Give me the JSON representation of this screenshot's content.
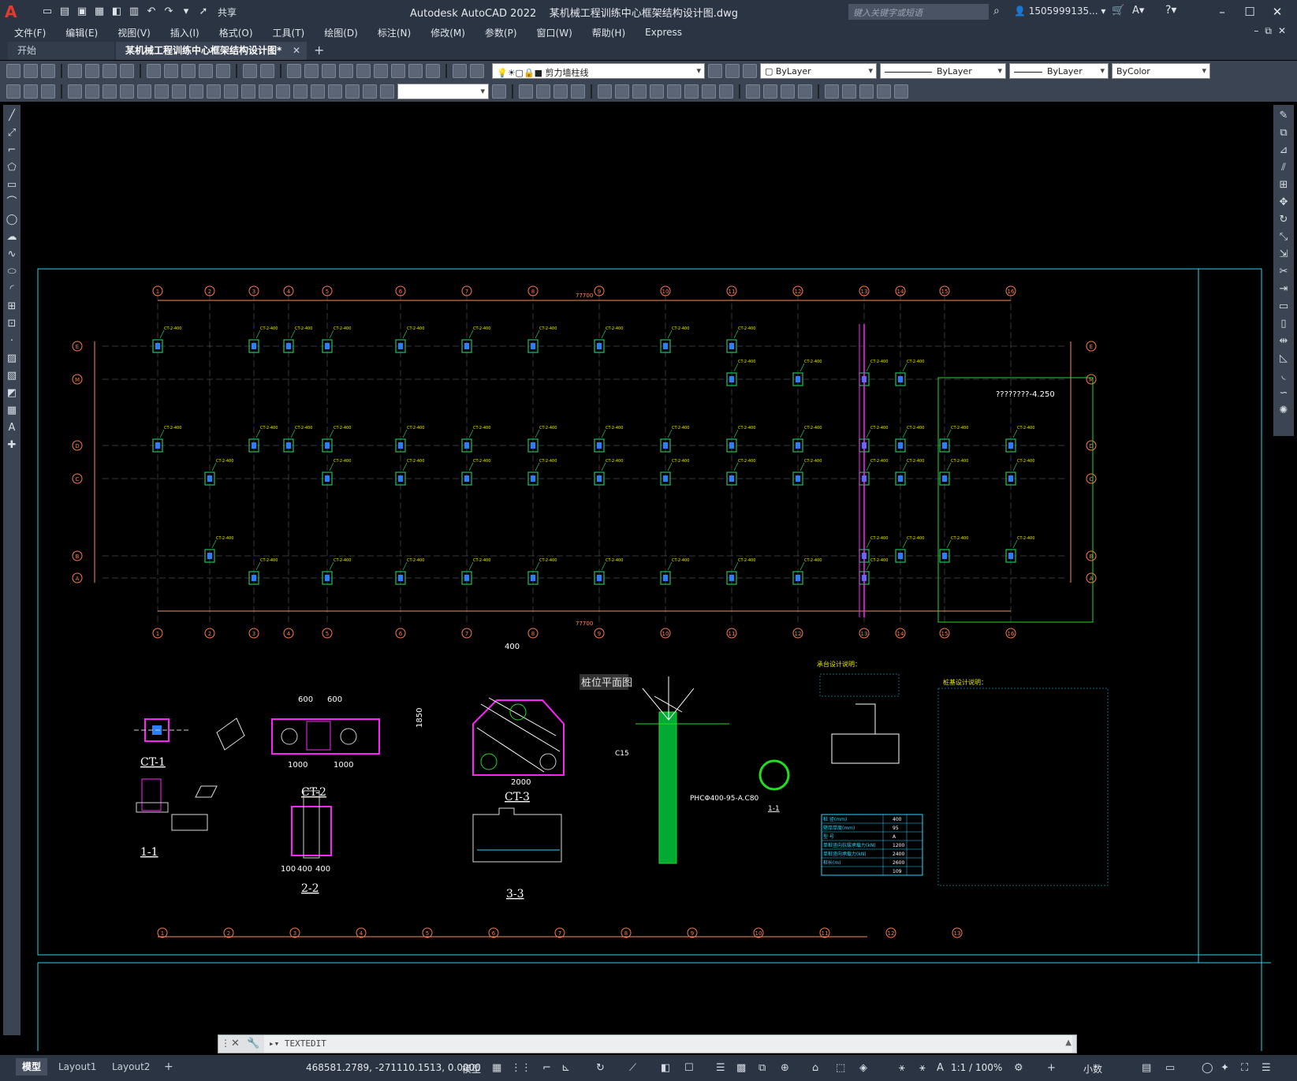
{
  "titlebar": {
    "app_title": "Autodesk AutoCAD 2022",
    "file_title": "某机械工程训练中心框架结构设计图.dwg",
    "share": "共享",
    "search_placeholder": "键入关键字或短语",
    "user": "1505999135...",
    "logo": "A"
  },
  "menu": [
    "文件(F)",
    "编辑(E)",
    "视图(V)",
    "插入(I)",
    "格式(O)",
    "工具(T)",
    "绘图(D)",
    "标注(N)",
    "修改(M)",
    "参数(P)",
    "窗口(W)",
    "帮助(H)",
    "Express"
  ],
  "tabs": {
    "start": "开始",
    "active": "某机械工程训练中心框架结构设计图*"
  },
  "properties": {
    "layer": "剪力墙柱线",
    "color": "ByLayer",
    "linetype": "ByLayer",
    "lineweight": "ByLayer",
    "plotstyle": "ByColor"
  },
  "command": {
    "text": "TEXTEDIT"
  },
  "layout_tabs": [
    "模型",
    "Layout1",
    "Layout2"
  ],
  "status": {
    "coords": "468581.2789, -271110.1513, 0.0000",
    "model": "模型",
    "scale": "1:1 / 100%",
    "units": "小数"
  },
  "drawing": {
    "plan_title": "桩位平面图",
    "axis_top": [
      "1",
      "2",
      "3",
      "4",
      "5",
      "6",
      "7",
      "8",
      "9",
      "10",
      "11",
      "12",
      "13",
      "14",
      "15",
      "16"
    ],
    "axis_side": [
      "E",
      "M",
      "D",
      "C",
      "B",
      "A"
    ],
    "overall_dim": "77700",
    "elev_note": "????????-4.250",
    "ct_label": "CT-2-400",
    "details": [
      "CT-1",
      "CT-2",
      "CT-3",
      "1-1",
      "2-2",
      "3-3",
      "1-1"
    ],
    "dims": {
      "ct2_a": "600",
      "ct2_b": "1000",
      "ct3_top": "400",
      "ct3_bot": "2000",
      "ct3_h": "1850",
      "d22": "100",
      "d22b": "400"
    },
    "pile_label": "PHCΦ400-95-A.C80",
    "pile_cap": "C15",
    "notes_left_title": "承台设计说明：",
    "notes_right_title": "桩基设计说明：",
    "table_rows": [
      "桩 径(mm)",
      "壁厚厚度(mm)",
      "型 号",
      "单桩竖向抗拔承载力(kN)",
      "单桩竖向承载力(kN)",
      "桩长(m)"
    ],
    "table_vals": [
      "400",
      "95",
      "A",
      "1200",
      "2400",
      "2600",
      "109"
    ]
  },
  "colors": {
    "axis": "#ff7a4a",
    "dim": "#ff8c5a",
    "grid_line": "#cfcfcf",
    "pile": "#2a7fff",
    "cap": "#20c060",
    "magenta": "#ff22ff",
    "green_box": "#22dd22",
    "frame": "#22d8e8",
    "text_yellow": "#e8e800",
    "text_cyan": "#22d8ff"
  }
}
